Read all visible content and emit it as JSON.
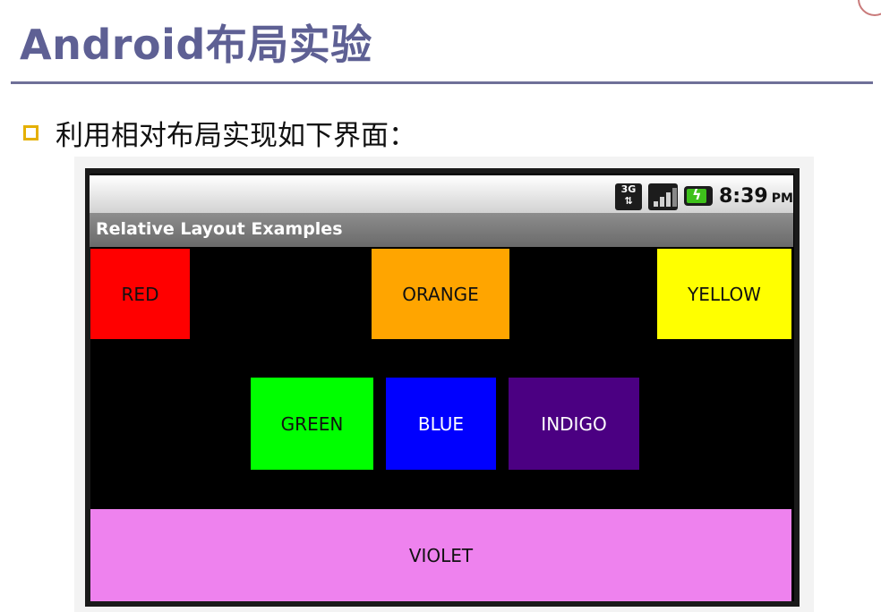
{
  "slide": {
    "title": "Android布局实验",
    "bullet_text": "利用相对布局实现如下界面："
  },
  "status_bar": {
    "network_badge": "3G",
    "time": "8:39",
    "ampm": "PM"
  },
  "app": {
    "title": "Relative Layout Examples"
  },
  "boxes": {
    "red": "RED",
    "orange": "ORANGE",
    "yellow": "YELLOW",
    "green": "GREEN",
    "blue": "BLUE",
    "indigo": "INDIGO",
    "violet": "VIOLET"
  },
  "colors": {
    "title_color": "#5e6094",
    "bullet_color": "#e5b000",
    "red": "#ff0000",
    "orange": "#ffa500",
    "yellow": "#ffff00",
    "green": "#00ff00",
    "blue": "#0000ff",
    "indigo": "#4b0082",
    "violet": "#ee82ee"
  }
}
